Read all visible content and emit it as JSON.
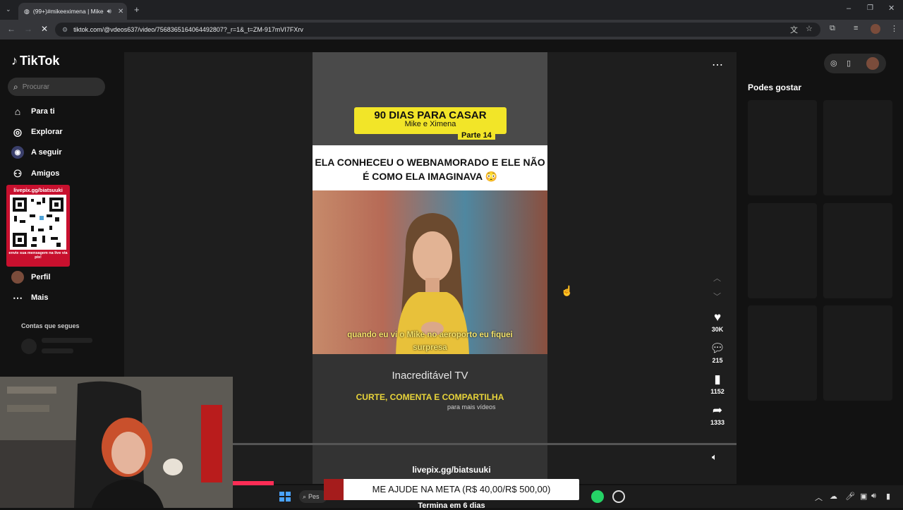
{
  "browser": {
    "tab_title": "(99+)#mikeeximena | Mike",
    "url": "tiktok.com/@vdeos637/video/7568365164064492807?_r=1&_t=ZM-917mVI7FXrv"
  },
  "tiktok": {
    "logo": "TikTok",
    "search_placeholder": "Procurar",
    "nav": [
      {
        "label": "Para ti",
        "icon": "home-icon"
      },
      {
        "label": "Explorar",
        "icon": "compass-icon"
      },
      {
        "label": "A seguir",
        "icon": "following-icon"
      },
      {
        "label": "Amigos",
        "icon": "friends-icon"
      }
    ],
    "nav_bottom": [
      {
        "label": "Perfil",
        "icon": "avatar-icon"
      },
      {
        "label": "Mais",
        "icon": "more-icon"
      }
    ],
    "following_title": "Contas que segues",
    "suggestions_title": "Podes gostar"
  },
  "qr_overlay": {
    "url": "livepix.gg/biatsuuki",
    "caption": "envie sua mensagem na live via pix!"
  },
  "video": {
    "badge_title": "90 DIAS PARA CASAR",
    "badge_subtitle": "Mike e Ximena",
    "badge_part": "Parte 14",
    "headline": "ELA CONHECEU O WEBNAMORADO E ELE NÃO É COMO ELA IMAGINAVA 😳",
    "subtitle": "quando eu vi o Mike no aeroporto eu fiquei surpresa",
    "brand": "Inacreditável TV",
    "cta": "CURTE, COMENTA E COMPARTILHA",
    "cta_small": "para mais vídeos"
  },
  "actions": {
    "likes": "30K",
    "comments": "215",
    "saves": "1152",
    "shares": "1333"
  },
  "stream_overlay": {
    "livepix_url": "livepix.gg/biatsuuki",
    "goal": "ME AJUDE NA META (R$ 40,00/R$ 500,00)",
    "ends": "Termina em 6 dias",
    "taskbar_search": "Pes"
  },
  "colors": {
    "accent": "#fe2c55",
    "badge_yellow": "#f2e528",
    "qr_red": "#c8102e"
  }
}
